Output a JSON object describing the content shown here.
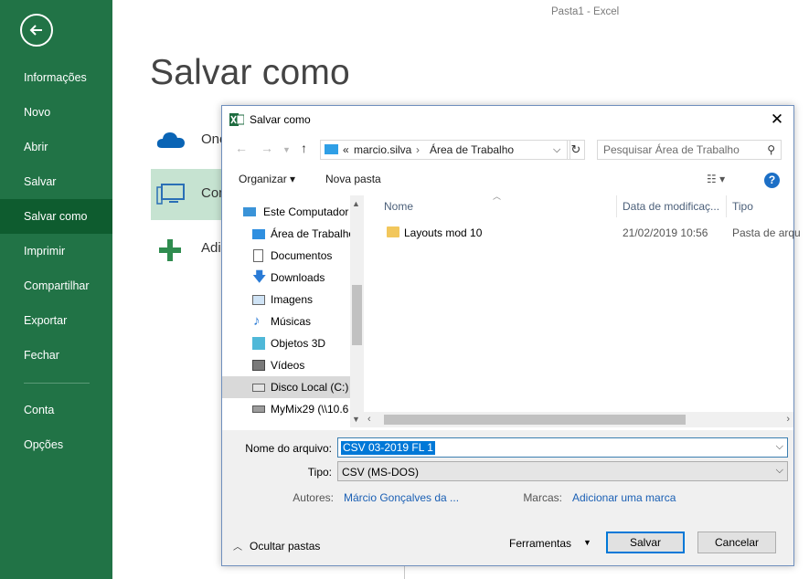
{
  "window_title": "Pasta1 - Excel",
  "backstage": {
    "back_icon": "back-arrow-icon",
    "items": [
      {
        "label": "Informações"
      },
      {
        "label": "Novo"
      },
      {
        "label": "Abrir"
      },
      {
        "label": "Salvar"
      },
      {
        "label": "Salvar como",
        "selected": true
      },
      {
        "label": "Imprimir"
      },
      {
        "label": "Compartilhar"
      },
      {
        "label": "Exportar"
      },
      {
        "label": "Fechar"
      },
      {
        "label": "Conta"
      },
      {
        "label": "Opções"
      }
    ],
    "colors": {
      "bg": "#217346",
      "selected": "#0e5c2f"
    }
  },
  "main": {
    "title": "Salvar como",
    "locations": [
      {
        "label": "One",
        "icon": "onedrive-cloud-icon"
      },
      {
        "label": "Con",
        "icon": "this-pc-icon",
        "selected": true
      },
      {
        "label": "Adi",
        "icon": "add-place-icon"
      }
    ]
  },
  "dialog": {
    "title": "Salvar como",
    "address": {
      "prefix": "«",
      "crumbs": [
        "marcio.silva",
        "Área de Trabalho"
      ]
    },
    "search": {
      "placeholder": "Pesquisar Área de Trabalho"
    },
    "toolbar": {
      "organize": "Organizar ▾",
      "new_folder": "Nova pasta",
      "view_icon": "view-options-icon",
      "help": "?"
    },
    "tree": [
      {
        "label": "Este Computador",
        "icon": "computer-icon"
      },
      {
        "label": "Área de Trabalho",
        "icon": "desktop-icon"
      },
      {
        "label": "Documentos",
        "icon": "documents-icon"
      },
      {
        "label": "Downloads",
        "icon": "downloads-icon"
      },
      {
        "label": "Imagens",
        "icon": "pictures-icon"
      },
      {
        "label": "Músicas",
        "icon": "music-icon"
      },
      {
        "label": "Objetos 3D",
        "icon": "3d-objects-icon"
      },
      {
        "label": "Vídeos",
        "icon": "videos-icon"
      },
      {
        "label": "Disco Local (C:)",
        "icon": "local-disk-icon",
        "selected": true
      },
      {
        "label": "MyMix29 (\\\\10.6",
        "icon": "network-drive-icon"
      }
    ],
    "columns": [
      "Nome",
      "Data de modificaç...",
      "Tipo"
    ],
    "files": [
      {
        "name": "Layouts mod 10",
        "date": "21/02/2019 10:56",
        "type": "Pasta de arqu",
        "icon": "folder-icon"
      }
    ],
    "form": {
      "file_name_label": "Nome do arquivo:",
      "file_name_value": "CSV 03-2019 FL 1",
      "type_label": "Tipo:",
      "type_value": "CSV (MS-DOS)",
      "authors_label": "Autores:",
      "authors_value": "Márcio Gonçalves da ...",
      "tags_label": "Marcas:",
      "tags_value": "Adicionar uma marca",
      "hide_folders": "Ocultar pastas",
      "tools": "Ferramentas",
      "save": "Salvar",
      "cancel": "Cancelar"
    }
  }
}
